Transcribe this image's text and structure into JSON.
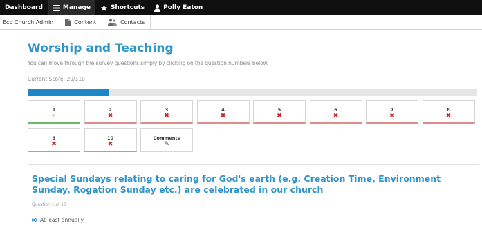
{
  "admin_bar": {
    "dashboard": "Dashboard",
    "manage": "Manage",
    "shortcuts": "Shortcuts",
    "user": "Polly Eaton"
  },
  "tray": {
    "site": "Eco Church Admin",
    "content": "Content",
    "contacts": "Contacts"
  },
  "page": {
    "title": "Worship and Teaching",
    "intro": "You can move through the survey questions simply by clicking on the question numbers below.",
    "score_label": "Current Score: ",
    "score_value": "20/110",
    "progress_fraction": 0.18
  },
  "questions": [
    {
      "label": "1",
      "status": "complete",
      "mark": "✓"
    },
    {
      "label": "2",
      "status": "incomplete",
      "mark": "✖"
    },
    {
      "label": "3",
      "status": "incomplete",
      "mark": "✖"
    },
    {
      "label": "4",
      "status": "incomplete",
      "mark": "✖"
    },
    {
      "label": "5",
      "status": "incomplete",
      "mark": "✖"
    },
    {
      "label": "6",
      "status": "incomplete",
      "mark": "✖"
    },
    {
      "label": "7",
      "status": "incomplete",
      "mark": "✖"
    },
    {
      "label": "8",
      "status": "incomplete",
      "mark": "✖"
    },
    {
      "label": "9",
      "status": "incomplete",
      "mark": "✖"
    },
    {
      "label": "10",
      "status": "incomplete",
      "mark": "✖"
    },
    {
      "label": "Comments",
      "status": "comments",
      "mark": "✎"
    }
  ],
  "current_question": {
    "title": "Special Sundays relating to caring for God's earth (e.g. Creation Time, Environment Sunday, Rogation Sunday etc.) are celebrated in our church",
    "counter": "Question 1 of 10",
    "answer": "At least annually"
  },
  "colors": {
    "accent": "#2f95c9",
    "progress": "#1c87c9",
    "ok": "#4aa84a",
    "bad": "#c62828"
  }
}
